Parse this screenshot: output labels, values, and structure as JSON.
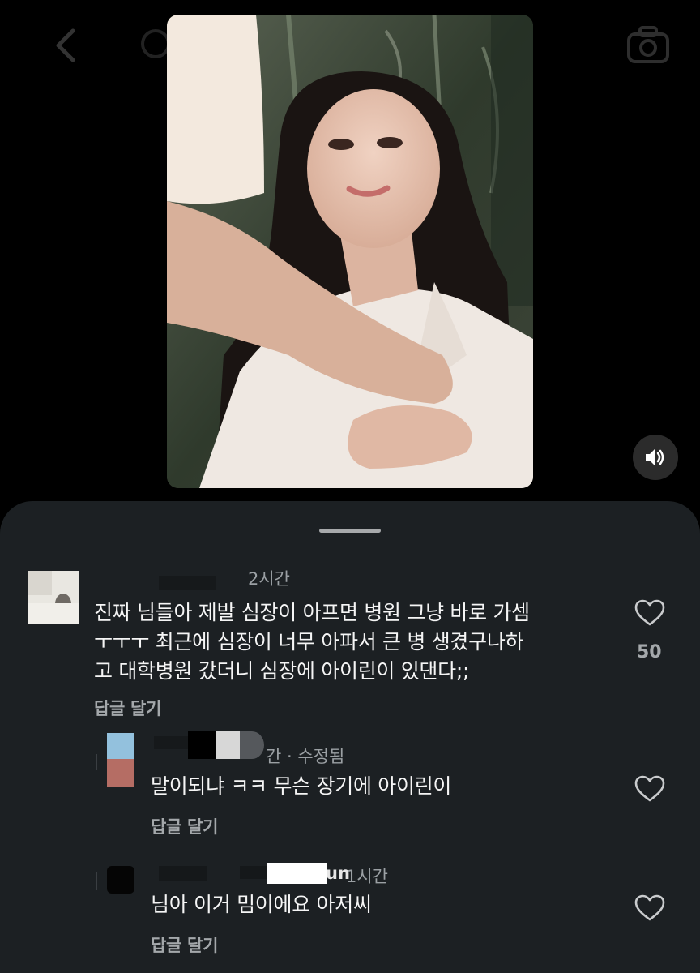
{
  "video": {
    "alt": "",
    "volume_icon": "speaker-icon"
  },
  "comments": {
    "main": {
      "time": "2시간",
      "text": "진짜 님들아 제발 심장이 아프면 병원 그냥 바로 가셈\nㅜㅜㅜ 최근에 심장이 너무 아파서 큰 병 생겼구나하\n고 대학병원 갔더니 심장에 아이린이 있댄다;;",
      "reply_label": "답글 달기",
      "like_count": "50"
    },
    "reply1": {
      "meta": "간 · 수정됨",
      "text": "말이되냐 ㅋㅋ 무슨 장기에 아이린이",
      "reply_label": "답글 달기"
    },
    "reply2": {
      "username_tail": "un",
      "time": "1시간",
      "text": "님아 이거 밈이에요 아저씨",
      "reply_label": "답글 달기"
    }
  },
  "colors": {
    "sheet_bg": "#1c2023",
    "text": "#f5f5f5",
    "muted": "#9ba0a4"
  }
}
